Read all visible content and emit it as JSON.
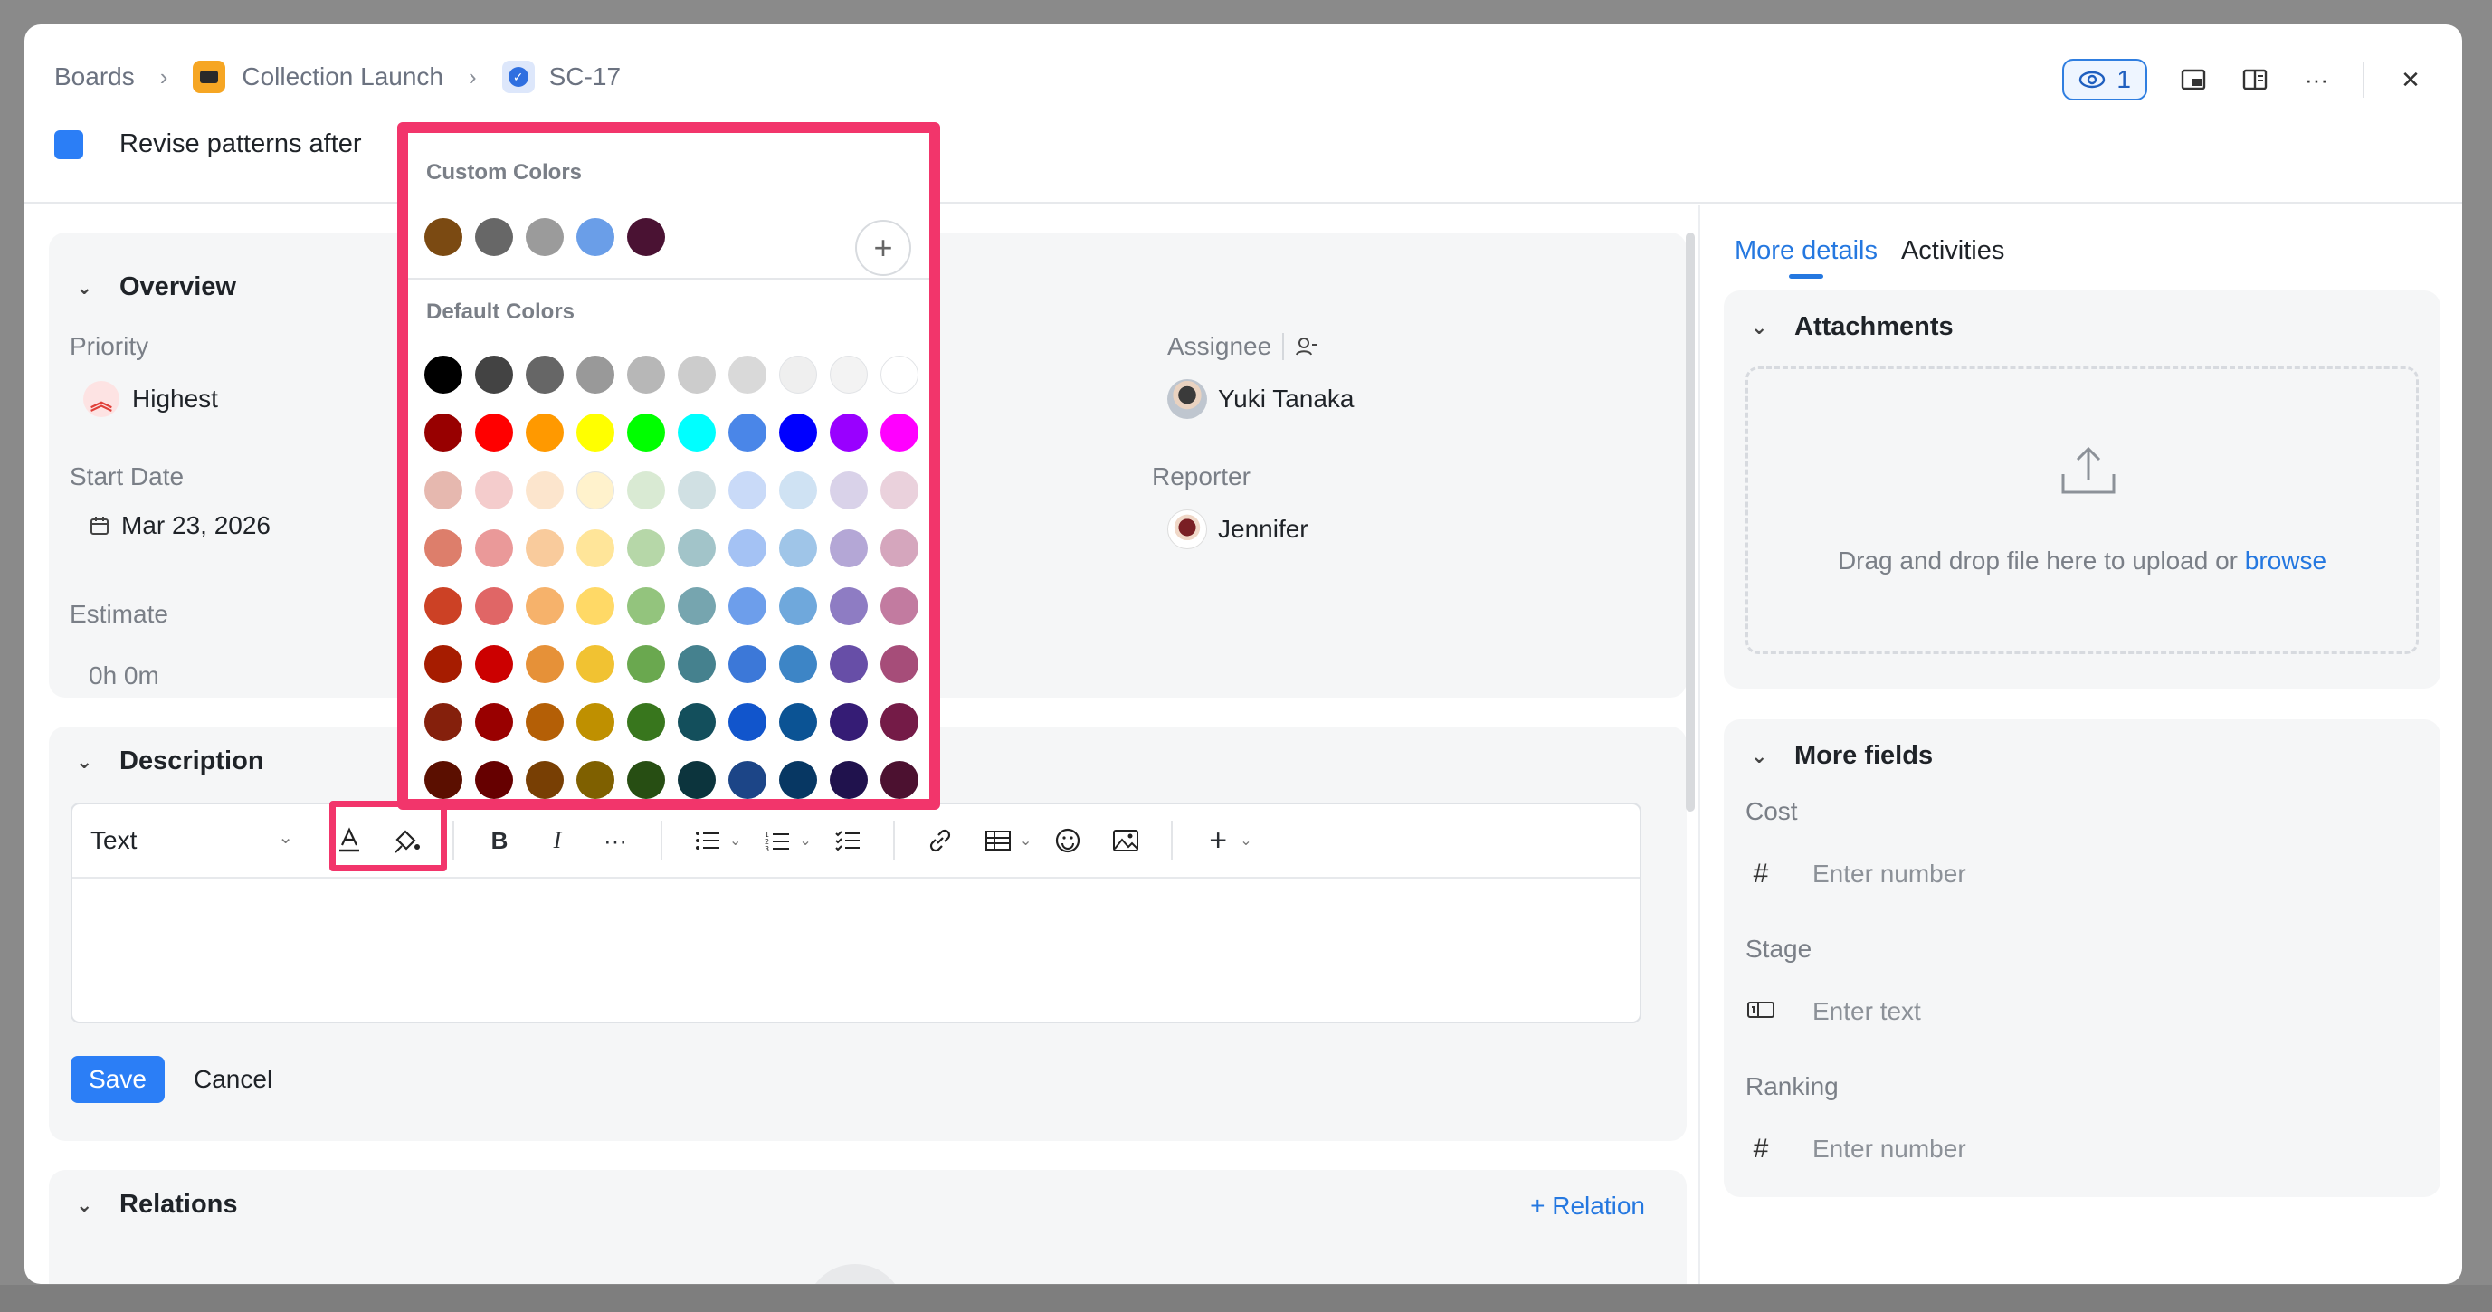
{
  "breadcrumb": {
    "boards": "Boards",
    "project": "Collection Launch",
    "task": "SC-17"
  },
  "title": "Revise patterns after",
  "watchers": "1",
  "overview": {
    "heading": "Overview",
    "priority_label": "Priority",
    "priority_value": "Highest",
    "start_label": "Start Date",
    "start_value": "Mar 23, 2026",
    "estimate_label": "Estimate",
    "estimate_value": "0h 0m",
    "assignee_label": "Assignee",
    "assignee_value": "Yuki Tanaka",
    "reporter_label": "Reporter",
    "reporter_value": "Jennifer"
  },
  "description": {
    "heading": "Description",
    "format": "Text",
    "save": "Save",
    "cancel": "Cancel"
  },
  "relations": {
    "heading": "Relations",
    "add": "+ Relation"
  },
  "tabs": {
    "details": "More details",
    "activities": "Activities"
  },
  "attachments": {
    "heading": "Attachments",
    "drop": "Drag and drop file here to upload or ",
    "browse": "browse"
  },
  "more_fields": {
    "heading": "More fields",
    "cost_label": "Cost",
    "cost_placeholder": "Enter number",
    "stage_label": "Stage",
    "stage_placeholder": "Enter text",
    "ranking_label": "Ranking",
    "ranking_placeholder": "Enter number"
  },
  "picker": {
    "custom_title": "Custom Colors",
    "default_title": "Default Colors",
    "custom_colors": [
      "#7b4a12",
      "#676767",
      "#9b9b9b",
      "#6a9ee8",
      "#4a1233"
    ],
    "default_colors": [
      [
        "#000000",
        "#434343",
        "#666666",
        "#999999",
        "#b7b7b7",
        "#cccccc",
        "#d9d9d9",
        "#efefef",
        "#f3f3f3",
        "#ffffff"
      ],
      [
        "#980000",
        "#ff0000",
        "#ff9900",
        "#ffff00",
        "#00ff00",
        "#00ffff",
        "#4a86e8",
        "#0000ff",
        "#9900ff",
        "#ff00ff"
      ],
      [
        "#e6b8af",
        "#f4cccc",
        "#fce5cd",
        "#fff2cc",
        "#d9ead3",
        "#d0e0e3",
        "#c9daf8",
        "#cfe2f3",
        "#d9d2e9",
        "#ead1dc"
      ],
      [
        "#dd7e6b",
        "#ea9999",
        "#f9cb9c",
        "#ffe599",
        "#b6d7a8",
        "#a2c4c9",
        "#a4c2f4",
        "#9fc5e8",
        "#b4a7d6",
        "#d5a6bd"
      ],
      [
        "#cc4125",
        "#e06666",
        "#f6b26b",
        "#ffd966",
        "#93c47d",
        "#76a5af",
        "#6d9eeb",
        "#6fa8dc",
        "#8e7cc3",
        "#c27ba0"
      ],
      [
        "#a61c00",
        "#cc0000",
        "#e69138",
        "#f1c232",
        "#6aa84f",
        "#45818e",
        "#3c78d8",
        "#3d85c6",
        "#674ea7",
        "#a64d79"
      ],
      [
        "#85200c",
        "#990000",
        "#b45f06",
        "#bf9000",
        "#38761d",
        "#134f5c",
        "#1155cc",
        "#0b5394",
        "#351c75",
        "#741b47"
      ],
      [
        "#5b0f00",
        "#660000",
        "#783f04",
        "#7f6000",
        "#274e13",
        "#0c343d",
        "#1c4587",
        "#073763",
        "#20124d",
        "#4c1130"
      ]
    ]
  }
}
